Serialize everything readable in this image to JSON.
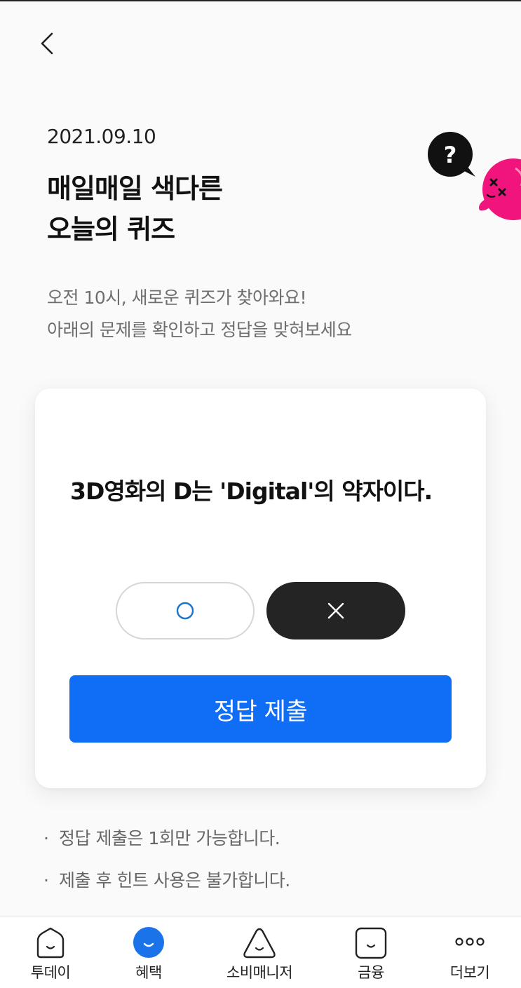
{
  "header": {
    "back_icon": "chevron-left-icon"
  },
  "quiz": {
    "date": "2021.09.10",
    "title_line1": "매일매일 색다른",
    "title_line2": "오늘의 퀴즈",
    "subtitle_line1": "오전 10시, 새로운 퀴즈가 찾아와요!",
    "subtitle_line2": "아래의 문제를 확인하고 정답을 맞혀보세요",
    "mascot_bubble": "?",
    "question": "3D영화의 D는 'Digital'의 약자이다.",
    "options": [
      {
        "icon": "circle-o-icon",
        "selected": false
      },
      {
        "icon": "close-x-icon",
        "selected": true
      }
    ],
    "submit_label": "정답 제출"
  },
  "notes": [
    "정답 제출은 1회만 가능합니다.",
    "제출 후 힌트 사용은 불가합니다."
  ],
  "note_bullet": "·",
  "tabbar": {
    "items": [
      {
        "label": "투데이",
        "icon": "home-face-icon",
        "active": false
      },
      {
        "label": "혜택",
        "icon": "benefit-face-icon",
        "active": true
      },
      {
        "label": "소비매니저",
        "icon": "triangle-face-icon",
        "active": false
      },
      {
        "label": "금융",
        "icon": "square-face-icon",
        "active": false
      },
      {
        "label": "더보기",
        "icon": "more-dots-icon",
        "active": false
      }
    ]
  },
  "colors": {
    "primary": "#0f6ef5",
    "selected_option": "#242424",
    "mascot": "#f0147c",
    "active_tab": "#1a73e8"
  }
}
